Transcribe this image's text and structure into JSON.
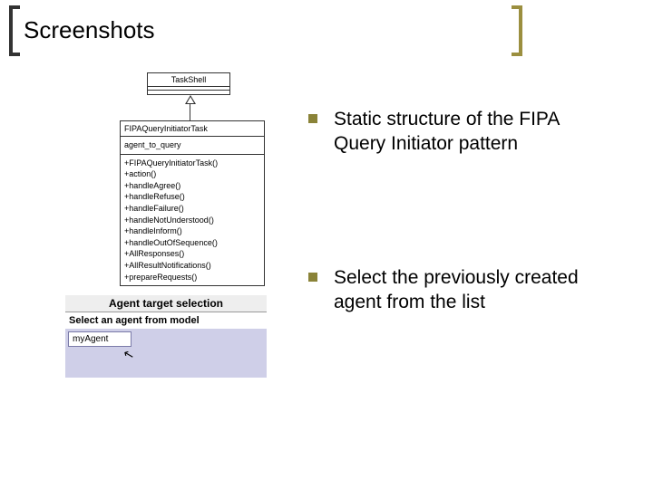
{
  "slide": {
    "title": "Screenshots"
  },
  "uml": {
    "parent_name": "TaskShell",
    "class_name": "FIPAQueryInitiatorTask",
    "attrs": [
      "agent_to_query"
    ],
    "ops": [
      "+FIPAQueryInitiatorTask()",
      "+action()",
      "+handleAgree()",
      "+handleRefuse()",
      "+handleFailure()",
      "+handleNotUnderstood()",
      "+handleInform()",
      "+handleOutOfSequence()",
      "+AllResponses()",
      "+AllResultNotifications()",
      "+prepareRequests()"
    ]
  },
  "wizard": {
    "title": "Agent target selection",
    "subtitle": "Select an agent from model",
    "selected": "myAgent"
  },
  "bullets": {
    "a": "Static structure of the FIPA Query Initiator pattern",
    "b": "Select the previously created agent from the list"
  }
}
